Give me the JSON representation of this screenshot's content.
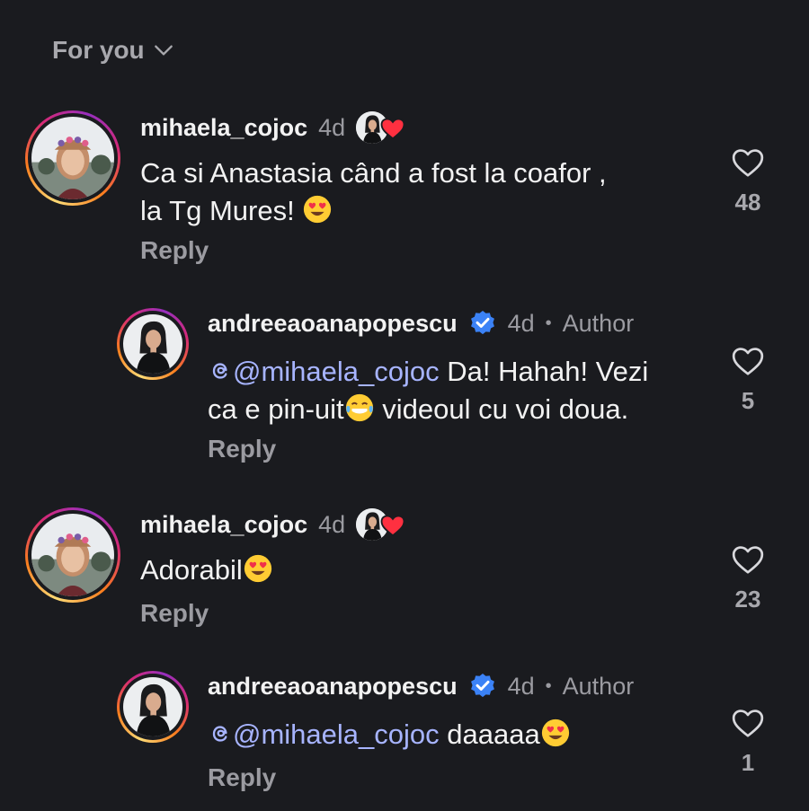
{
  "header": {
    "sort_label": "For you"
  },
  "comments": [
    {
      "username": "mihaela_cojoc",
      "time": "4d",
      "text": "Ca si Anastasia când a fost la coafor ,",
      "text2": "la Tg Mures!",
      "reply_label": "Reply",
      "likes": "48"
    },
    {
      "username": "andreeaoanapopescu",
      "time": "4d",
      "author_label": "Author",
      "mention": "@mihaela_cojoc",
      "text": "Da! Hahah! Vezi",
      "text2a": "ca e pin-uit",
      "text2b": " videoul cu voi doua.",
      "reply_label": "Reply",
      "likes": "5"
    },
    {
      "username": "mihaela_cojoc",
      "time": "4d",
      "text": "Adorabil",
      "reply_label": "Reply",
      "likes": "23"
    },
    {
      "username": "andreeaoanapopescu",
      "time": "4d",
      "author_label": "Author",
      "mention": "@mihaela_cojoc",
      "text": "daaaaa",
      "reply_label": "Reply",
      "likes": "1"
    }
  ],
  "colors": {
    "background": "#1a1b1f",
    "mention": "#a7b4ff",
    "verified": "#3b82f6",
    "heart_liked": "#ff3040"
  }
}
